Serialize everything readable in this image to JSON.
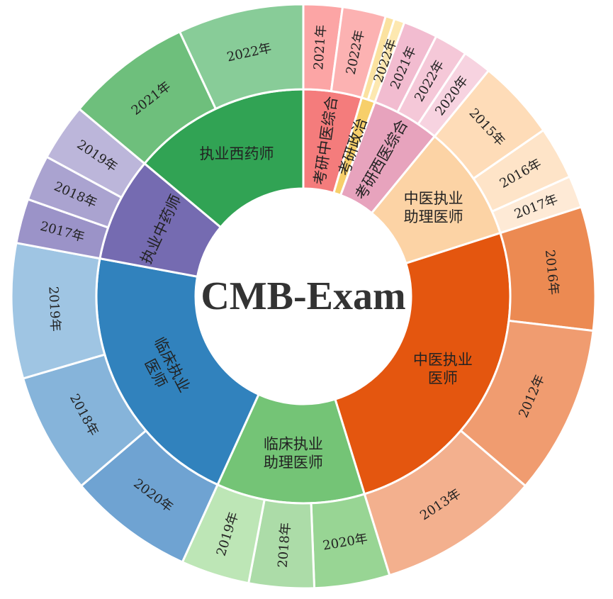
{
  "chart_data": {
    "type": "sunburst",
    "center_title": "CMB-Exam",
    "start_angle_deg": 0,
    "direction": "clockwise",
    "inner": [
      {
        "name": "考研中医综合",
        "lines": [
          "考研中医综合"
        ],
        "color": "#f47c7c",
        "text_rotate": "radial"
      },
      {
        "name": "考研政治",
        "lines": [
          "考研政治"
        ],
        "color": "#f7cf6a",
        "text_rotate": "radial"
      },
      {
        "name": "考研西医综合",
        "lines": [
          "考研西医综合"
        ],
        "color": "#e7a3bd",
        "text_rotate": "radial"
      },
      {
        "name": "中医执业助理医师",
        "lines": [
          "中医执业",
          "助理医师"
        ],
        "color": "#fcd3a5",
        "text_rotate": "horizontal"
      },
      {
        "name": "中医执业医师",
        "lines": [
          "中医执业",
          "医师"
        ],
        "color": "#e4560f",
        "text_rotate": "horizontal"
      },
      {
        "name": "临床执业助理医师",
        "lines": [
          "临床执业",
          "助理医师"
        ],
        "color": "#74c476",
        "text_rotate": "horizontal"
      },
      {
        "name": "临床执业医师",
        "lines": [
          "临床执业",
          "医师"
        ],
        "color": "#3182bd",
        "text_rotate": "tangent"
      },
      {
        "name": "执业中药师",
        "lines": [
          "执业中药师"
        ],
        "color": "#756bb1",
        "text_rotate": "tangent"
      },
      {
        "name": "执业西药师",
        "lines": [
          "执业西药师"
        ],
        "color": "#31a354",
        "text_rotate": "horizontal"
      }
    ],
    "outer": [
      {
        "parent": "考研中医综合",
        "label": "2021年",
        "value": 3.4,
        "color": "#fca5a5"
      },
      {
        "parent": "考研中医综合",
        "label": "2022年",
        "value": 3.8,
        "color": "#fcb2b2"
      },
      {
        "parent": "考研政治",
        "label": "",
        "value": 0.8,
        "color": "#fbe2a0"
      },
      {
        "parent": "考研政治",
        "label": "2022年",
        "value": 0.9,
        "color": "#fde8b0"
      },
      {
        "parent": "考研西医综合",
        "label": "2021年",
        "value": 3.0,
        "color": "#f2bcd0"
      },
      {
        "parent": "考研西医综合",
        "label": "2022年",
        "value": 2.9,
        "color": "#f5c8d8"
      },
      {
        "parent": "考研西医综合",
        "label": "2020年",
        "value": 2.5,
        "color": "#f7d3e0"
      },
      {
        "parent": "中医执业助理医师",
        "label": "2015年",
        "value": 7.0,
        "color": "#fedcb8"
      },
      {
        "parent": "中医执业助理医师",
        "label": "2016年",
        "value": 4.6,
        "color": "#fee4c8"
      },
      {
        "parent": "中医执业助理医师",
        "label": "2017年",
        "value": 2.8,
        "color": "#feead6"
      },
      {
        "parent": "中医执业医师",
        "label": "2016年",
        "value": 10.8,
        "color": "#ec8a52"
      },
      {
        "parent": "中医执业医师",
        "label": "2012年",
        "value": 14.8,
        "color": "#f09c70"
      },
      {
        "parent": "中医执业医师",
        "label": "2013年",
        "value": 14.2,
        "color": "#f3b08e"
      },
      {
        "parent": "临床执业助理医师",
        "label": "2020年",
        "value": 6.6,
        "color": "#98d594"
      },
      {
        "parent": "临床执业助理医师",
        "label": "2018年",
        "value": 5.7,
        "color": "#acdca8"
      },
      {
        "parent": "临床执业助理医师",
        "label": "2019年",
        "value": 6.0,
        "color": "#bde6b6"
      },
      {
        "parent": "临床执业医师",
        "label": "2020年",
        "value": 11.0,
        "color": "#6fa3d2"
      },
      {
        "parent": "临床执业医师",
        "label": "2018年",
        "value": 10.6,
        "color": "#86b4da"
      },
      {
        "parent": "临床执业医师",
        "label": "2019年",
        "value": 11.8,
        "color": "#9fc5e3"
      },
      {
        "parent": "执业中药师",
        "label": "2017年",
        "value": 3.9,
        "color": "#9b93c8"
      },
      {
        "parent": "执业中药师",
        "label": "2018年",
        "value": 4.0,
        "color": "#aaa3d0"
      },
      {
        "parent": "执业中药师",
        "label": "2019年",
        "value": 5.0,
        "color": "#bcb6da"
      },
      {
        "parent": "执业西药师",
        "label": "2021年",
        "value": 11.0,
        "color": "#6ebf7c"
      },
      {
        "parent": "执业西药师",
        "label": "2022年",
        "value": 11.0,
        "color": "#88cc98"
      }
    ]
  }
}
